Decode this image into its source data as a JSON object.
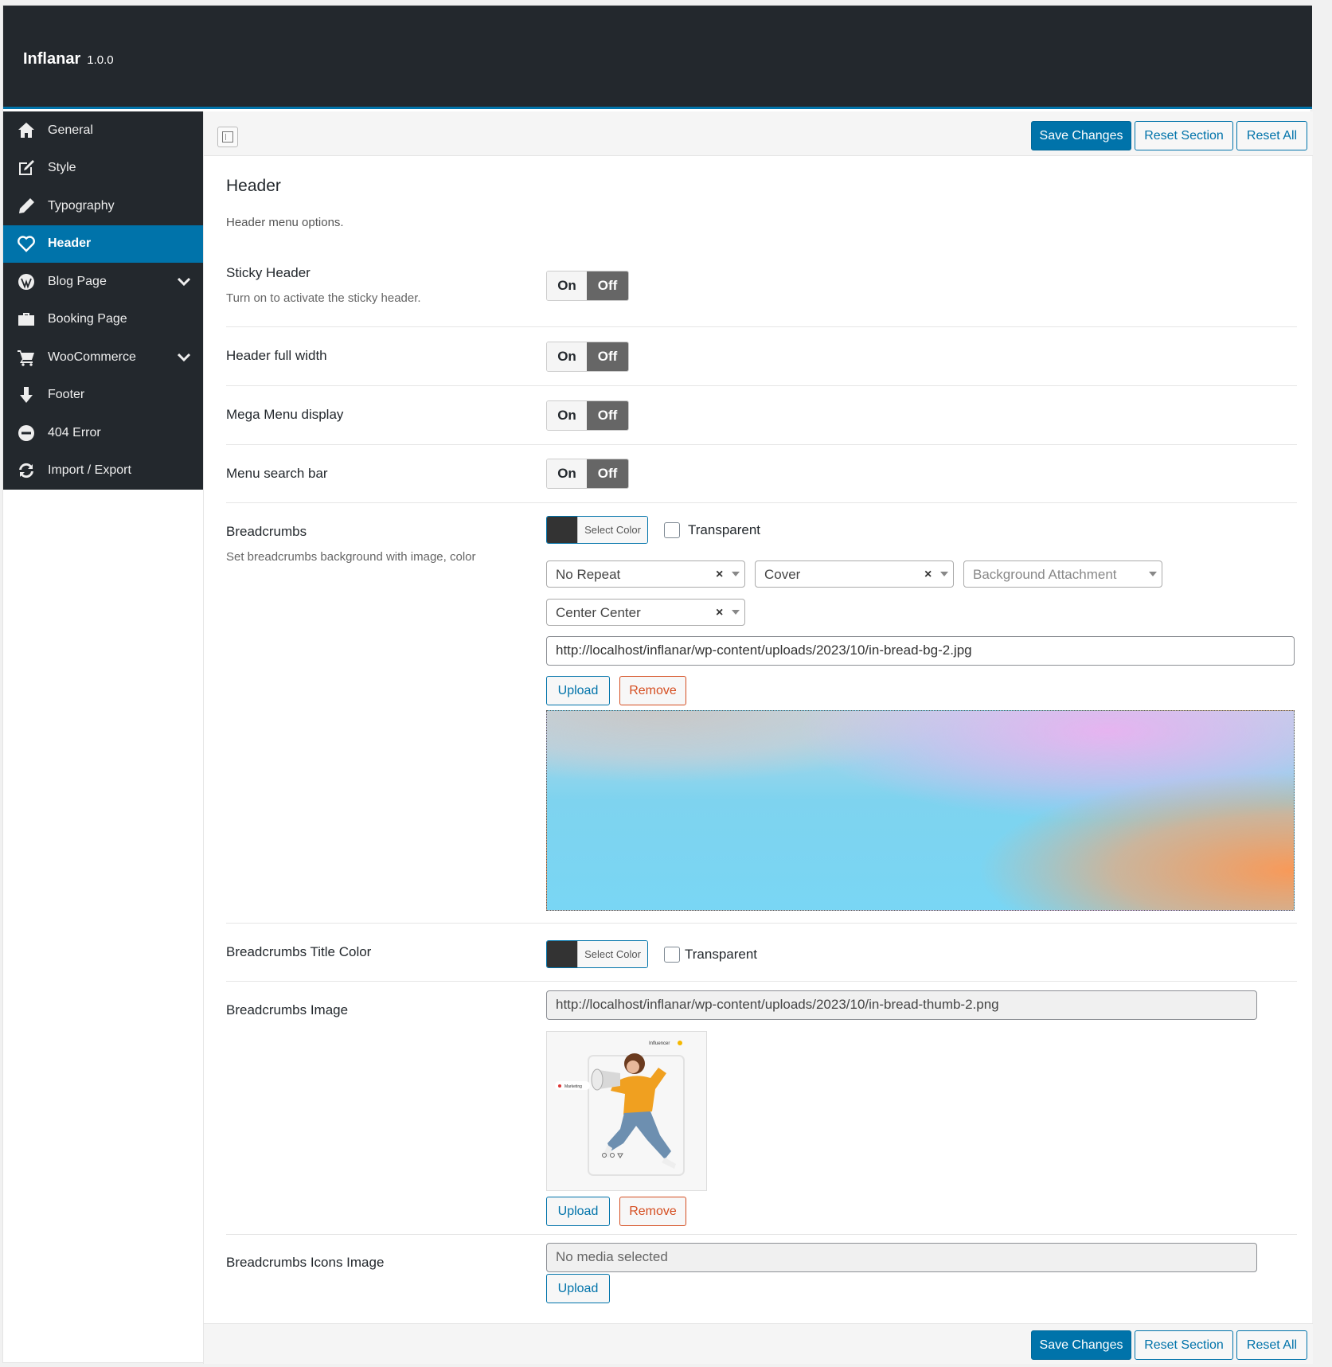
{
  "app": {
    "name": "Inflanar",
    "version": "1.0.0"
  },
  "sidebar": {
    "items": [
      {
        "label": "General",
        "icon": "home-icon"
      },
      {
        "label": "Style",
        "icon": "edit-icon"
      },
      {
        "label": "Typography",
        "icon": "pencil-icon"
      },
      {
        "label": "Header",
        "icon": "heart-icon",
        "active": true
      },
      {
        "label": "Blog Page",
        "icon": "wordpress-icon",
        "expandable": true
      },
      {
        "label": "Booking Page",
        "icon": "briefcase-icon"
      },
      {
        "label": "WooCommerce",
        "icon": "cart-icon",
        "expandable": true
      },
      {
        "label": "Footer",
        "icon": "arrow-down-icon"
      },
      {
        "label": "404 Error",
        "icon": "minus-circle-icon"
      },
      {
        "label": "Import / Export",
        "icon": "refresh-icon"
      }
    ]
  },
  "toolbar": {
    "save": "Save Changes",
    "reset_section": "Reset Section",
    "reset_all": "Reset All"
  },
  "section": {
    "title": "Header",
    "desc": "Header menu options."
  },
  "fields": {
    "sticky": {
      "label": "Sticky Header",
      "desc": "Turn on to activate the sticky header.",
      "on": "On",
      "off": "Off",
      "value": "Off"
    },
    "full_width": {
      "label": "Header full width",
      "on": "On",
      "off": "Off",
      "value": "Off"
    },
    "mega_menu": {
      "label": "Mega Menu display",
      "on": "On",
      "off": "Off",
      "value": "Off"
    },
    "search_bar": {
      "label": "Menu search bar",
      "on": "On",
      "off": "Off",
      "value": "Off"
    },
    "breadcrumbs": {
      "label": "Breadcrumbs",
      "desc": "Set breadcrumbs background with image, color",
      "select_color": "Select Color",
      "color": "#333333",
      "transparent": "Transparent",
      "repeat": "No Repeat",
      "size": "Cover",
      "attachment_placeholder": "Background Attachment",
      "position": "Center Center",
      "url": "http://localhost/inflanar/wp-content/uploads/2023/10/in-bread-bg-2.jpg",
      "upload": "Upload",
      "remove": "Remove"
    },
    "title_color": {
      "label": "Breadcrumbs Title Color",
      "select_color": "Select Color",
      "color": "#333333",
      "transparent": "Transparent"
    },
    "image": {
      "label": "Breadcrumbs Image",
      "url": "http://localhost/inflanar/wp-content/uploads/2023/10/in-bread-thumb-2.png",
      "thumb_tag_top": "Influencer",
      "thumb_tag_left": "Marketing",
      "upload": "Upload",
      "remove": "Remove"
    },
    "icons_image": {
      "label": "Breadcrumbs Icons Image",
      "placeholder": "No media selected",
      "upload": "Upload"
    }
  },
  "colors": {
    "accent": "#0073aa",
    "sidebar_bg": "#23282d",
    "remove": "#d54e21",
    "toggle_off": "#666666"
  }
}
